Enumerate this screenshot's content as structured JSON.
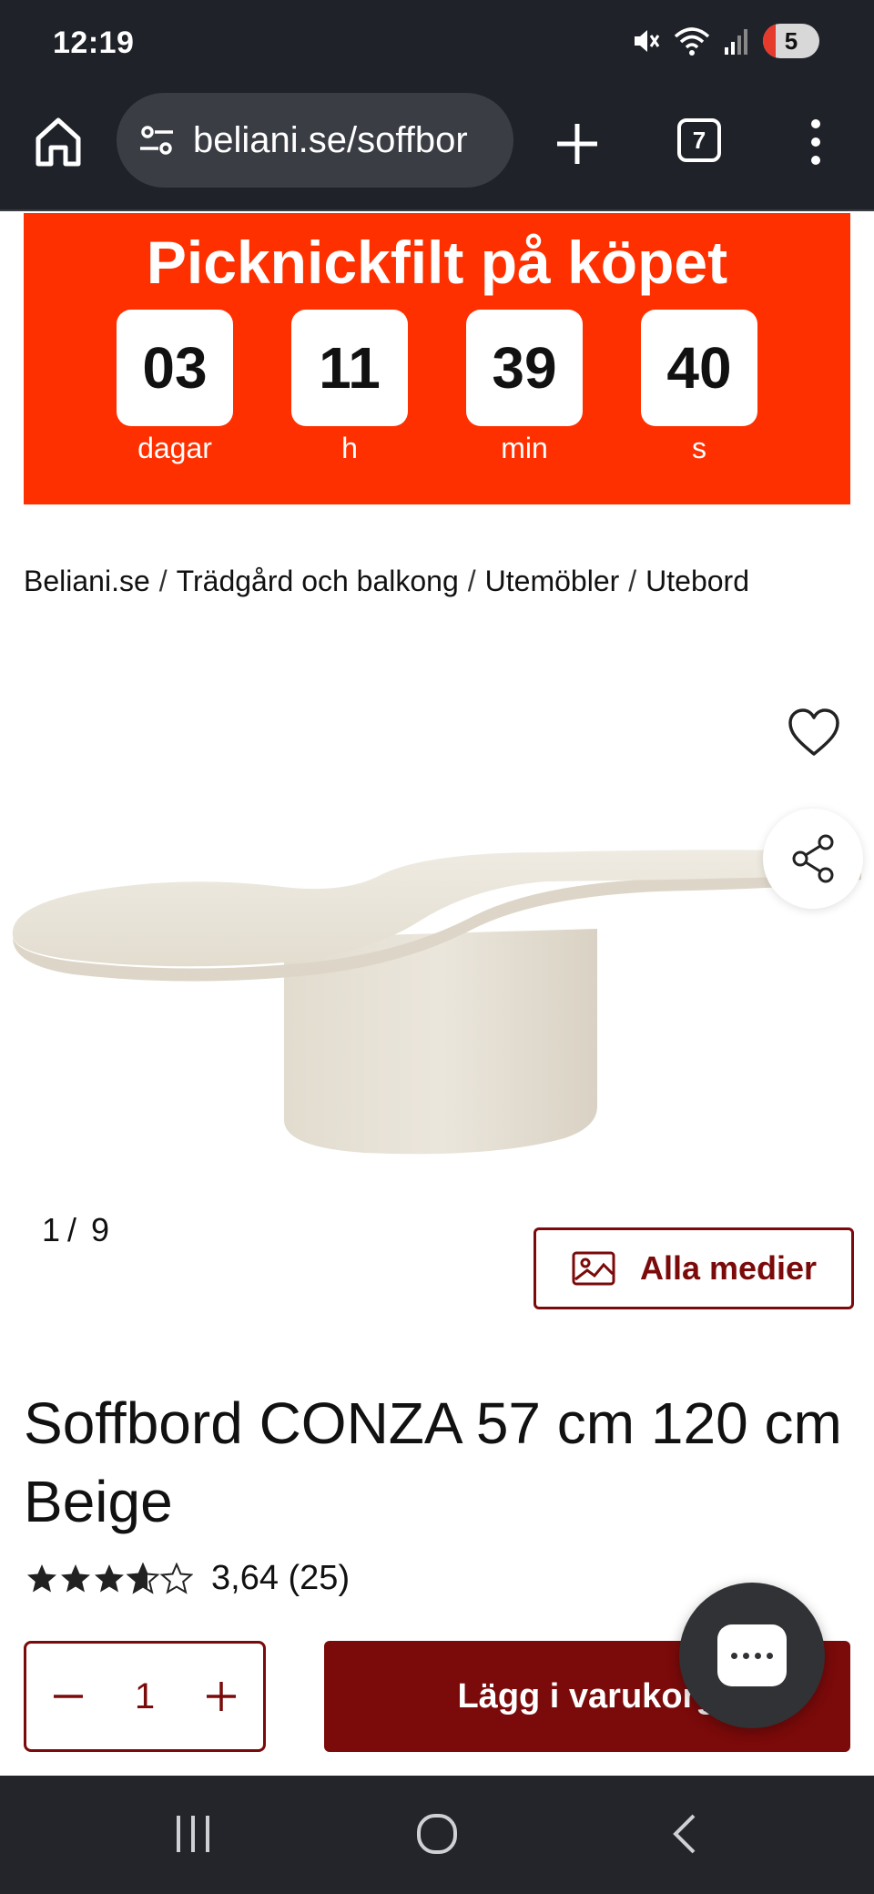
{
  "status_bar": {
    "time": "12:19",
    "notification_count": "5",
    "icons": [
      "mute-icon",
      "wifi-icon",
      "signal-icon"
    ]
  },
  "browser": {
    "url": "beliani.se/soffbor",
    "tab_count": "7",
    "icons": [
      "home-icon",
      "site-settings-icon",
      "new-tab-icon",
      "tab-switcher-icon",
      "more-menu-icon"
    ]
  },
  "promo": {
    "title": "Picknickfilt på köpet",
    "countdown": [
      {
        "value": "03",
        "label": "dagar"
      },
      {
        "value": "11",
        "label": "h"
      },
      {
        "value": "39",
        "label": "min"
      },
      {
        "value": "40",
        "label": "s"
      }
    ],
    "background_color": "#ff3000"
  },
  "breadcrumb": [
    "Beliani.se",
    "Trädgård och balkong",
    "Utemöbler",
    "Utebord"
  ],
  "gallery": {
    "current": "1",
    "separator": "/",
    "total": "9",
    "all_media_label": "Alla medier"
  },
  "product": {
    "title": "Soffbord CONZA 57 cm 120 cm Beige",
    "rating_value": 3.64,
    "rating_text": "3,64 (25)",
    "max_stars": 5
  },
  "purchase": {
    "quantity": "1",
    "add_to_cart_label": "Lägg i varukorg",
    "brand_color": "#7b0a0a"
  },
  "nav_bar": {
    "icons": [
      "recent-apps-icon",
      "home-nav-icon",
      "back-icon"
    ]
  }
}
